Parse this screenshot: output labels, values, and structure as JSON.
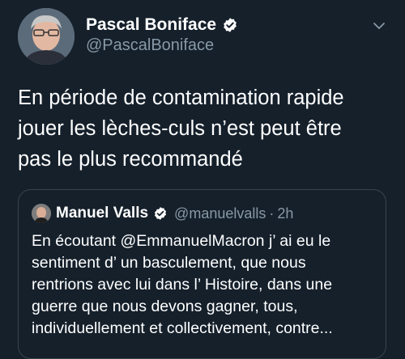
{
  "colors": {
    "background": "#15202b",
    "text_primary": "#ffffff",
    "text_secondary": "#8899a6",
    "verified_badge": "#ffffff",
    "quote_border": "#38444d"
  },
  "tweet": {
    "author": {
      "name": "Pascal Boniface",
      "handle": "@PascalBoniface",
      "verified": true,
      "avatar_icon": "avatar-photo"
    },
    "menu_icon": "chevron-down-icon",
    "text": "En période de contamination rapide\njouer les lèches-culs n’est peut être\npas le plus recommandé",
    "quoted_tweet": {
      "author": {
        "name": "Manuel Valls",
        "handle": "@manuelvalls",
        "verified": true,
        "avatar_icon": "avatar-photo"
      },
      "separator": "·",
      "time": "2h",
      "text": "En écoutant @EmmanuelMacron j’ ai eu le\nsentiment d’ un basculement, que nous\nrentrions avec lui dans l’ Histoire, dans une\nguerre que nous devons gagner,  tous,\nindividuellement et collectivement, contre..."
    }
  }
}
